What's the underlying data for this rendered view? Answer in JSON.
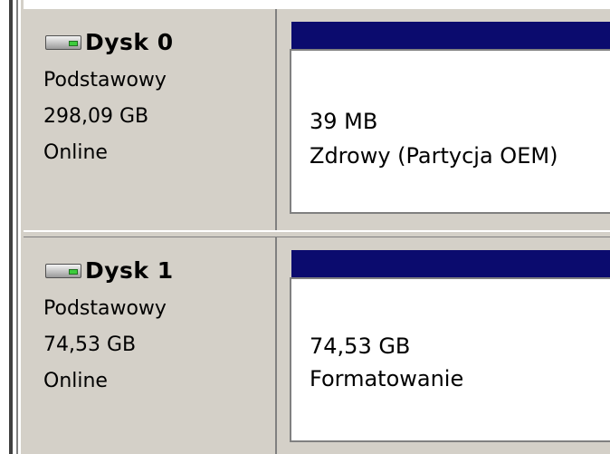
{
  "disks": [
    {
      "name": "Dysk 0",
      "type": "Podstawowy",
      "size": "298,09 GB",
      "status": "Online",
      "partition": {
        "size": "39 MB",
        "status": "Zdrowy (Partycja OEM)"
      }
    },
    {
      "name": "Dysk 1",
      "type": "Podstawowy",
      "size": "74,53 GB",
      "status": "Online",
      "partition": {
        "size": "74,53 GB",
        "status": "Formatowanie"
      }
    }
  ],
  "colors": {
    "panel_bg": "#d4d0c8",
    "partition_header": "#0b0b6e",
    "partition_bg": "#ffffff",
    "dark_bar": "#404040"
  },
  "icons": {
    "disk": "hard-disk-icon"
  }
}
